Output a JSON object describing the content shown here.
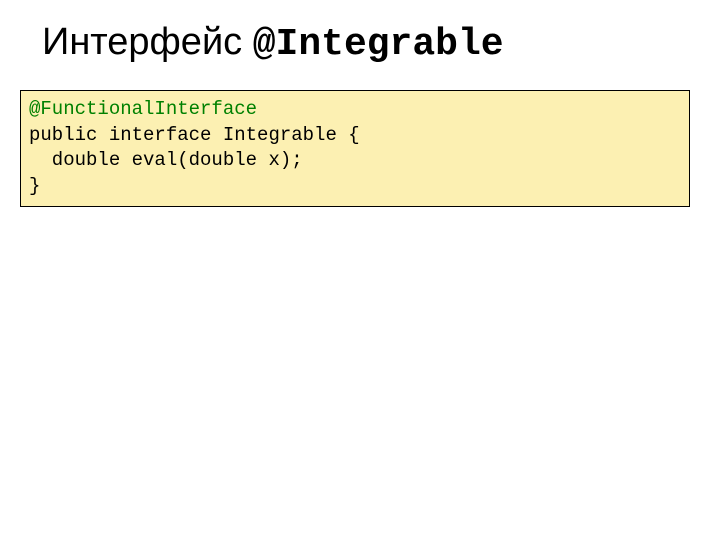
{
  "title": {
    "text_part": "Интерфейс ",
    "mono_part": "@Integrable"
  },
  "code": {
    "annotation": "@FunctionalInterface",
    "line2": "public interface Integrable {",
    "line3": "  double eval(double x);",
    "line4": "}"
  }
}
